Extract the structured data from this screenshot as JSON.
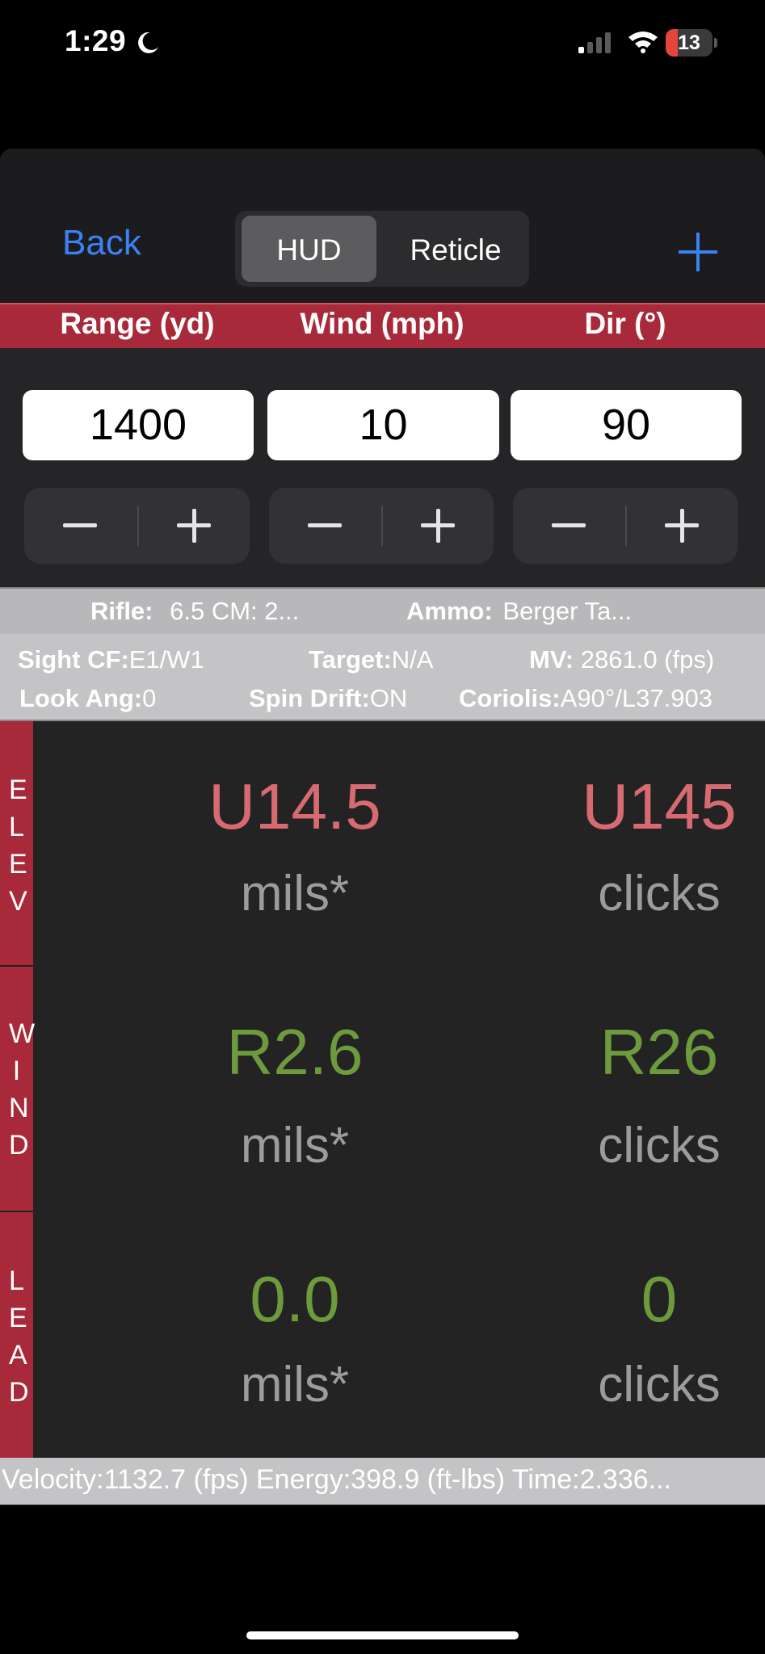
{
  "status": {
    "time": "1:29",
    "battery": "13"
  },
  "nav": {
    "back": "Back",
    "segments": [
      "HUD",
      "Reticle"
    ],
    "selected_segment": "HUD"
  },
  "headers": {
    "range": "Range (yd)",
    "wind": "Wind (mph)",
    "dir": "Dir (°)"
  },
  "inputs": {
    "range": "1400",
    "wind": "10",
    "dir": "90"
  },
  "rifle_info": {
    "rifle_label": "Rifle:",
    "rifle_value": "6.5 CM: 2...",
    "ammo_label": "Ammo:",
    "ammo_value": "Berger Ta..."
  },
  "details": {
    "sight_cf_label": "Sight CF:",
    "sight_cf_value": "E1/W1",
    "target_label": "Target:",
    "target_value": "N/A",
    "mv_label": "MV:",
    "mv_value": "2861.0 (fps)",
    "look_ang_label": "Look Ang:",
    "look_ang_value": "0",
    "spin_drift_label": "Spin Drift:",
    "spin_drift_value": "ON",
    "coriolis_label": "Coriolis:",
    "coriolis_value": "A90°/L37.903"
  },
  "hud": {
    "elev": {
      "side": "ELEV",
      "mils": "U14.5",
      "mils_unit": "mils*",
      "clicks": "U145",
      "clicks_unit": "clicks"
    },
    "wind": {
      "side": "WIND",
      "mils": "R2.6",
      "mils_unit": "mils*",
      "clicks": "R26",
      "clicks_unit": "clicks"
    },
    "lead": {
      "side": "LEAD",
      "mils": "0.0",
      "mils_unit": "mils*",
      "clicks": "0",
      "clicks_unit": "clicks"
    }
  },
  "footer": {
    "text": "Velocity:1132.7 (fps)  Energy:398.9 (ft-lbs) Time:2.336..."
  },
  "colors": {
    "accent_blue": "#3a82f6",
    "header_red": "#a8293a",
    "elev_red": "#d86b72",
    "wind_green": "#6c9a3c"
  }
}
